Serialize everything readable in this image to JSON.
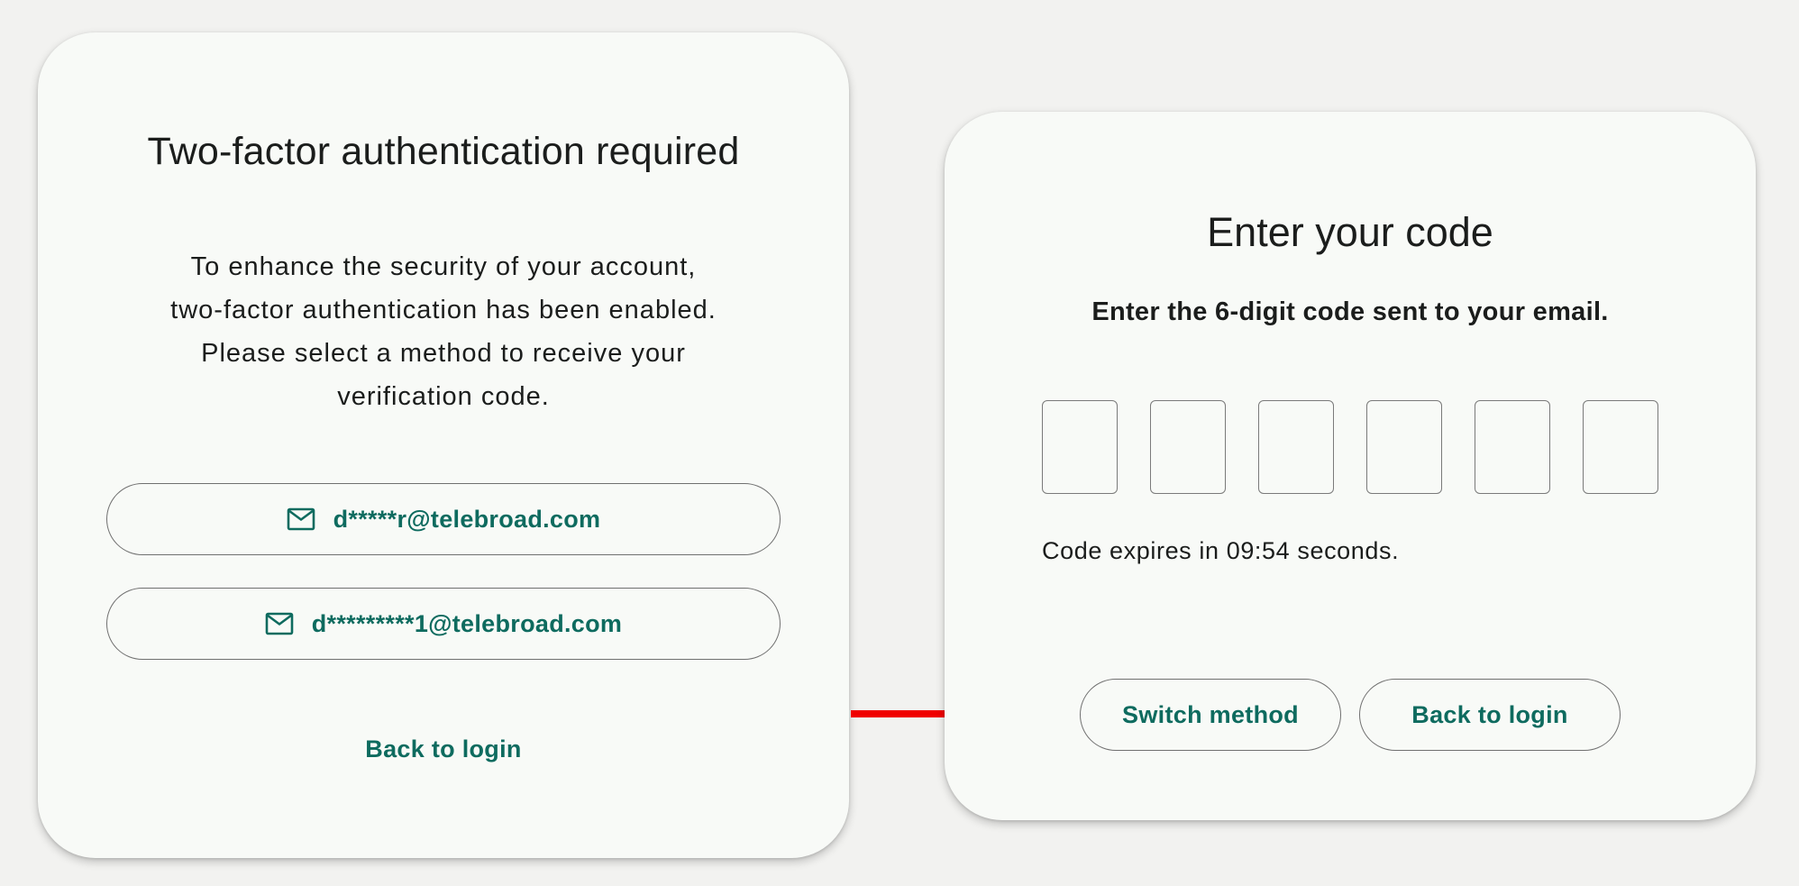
{
  "left_card": {
    "title": "Two-factor authentication required",
    "description_lines": [
      "To enhance the security of your account,",
      "two-factor authentication has been enabled.",
      "Please select a method to receive your",
      "verification code."
    ],
    "methods": [
      {
        "icon": "mail-icon",
        "label": "d*****r@telebroad.com"
      },
      {
        "icon": "mail-icon",
        "label": "d*********1@telebroad.com"
      }
    ],
    "back_link": "Back to login"
  },
  "right_card": {
    "title": "Enter your code",
    "subtitle": "Enter the 6-digit code sent to your email.",
    "code_length": 6,
    "expires_text": "Code expires in 09:54 seconds.",
    "switch_button": "Switch method",
    "back_button": "Back to login"
  },
  "colors": {
    "accent": "#0e6b5f",
    "card_background": "#f8faf7",
    "page_background": "#f2f2f0",
    "arrow": "#f00000"
  }
}
